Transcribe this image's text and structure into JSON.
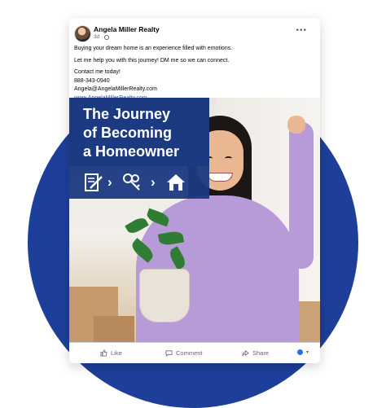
{
  "post": {
    "author": "Angela Miller Realty",
    "time": "3d",
    "text_line1": "Buying your dream home is an experience filled with emotions.",
    "text_line2": "Let me help you with this journey! DM me so we can connect.",
    "text_line3": "Contact me today!",
    "phone": "888-343-0940",
    "email": "Angela@AngelaMillerRealty.com",
    "website": "www.AngelaMillerRealty.com"
  },
  "graphic": {
    "title_line1": "The Journey",
    "title_line2": "of Becoming",
    "title_line3": "a Homeowner",
    "steps": [
      "document-sign-icon",
      "keys-icon",
      "house-icon"
    ]
  },
  "actions": {
    "like": "Like",
    "comment": "Comment",
    "share": "Share"
  },
  "colors": {
    "brand_blue": "#1c3a82",
    "circle_blue": "#1d3f9a",
    "link": "#385898"
  }
}
